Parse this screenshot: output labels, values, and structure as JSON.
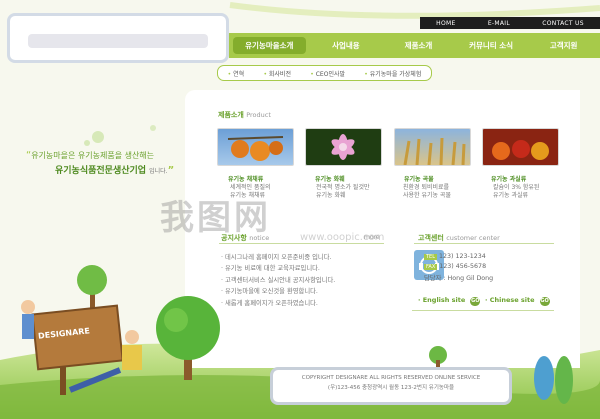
{
  "topbar": {
    "items": [
      "HOME",
      "E-MAIL",
      "CONTACT US"
    ]
  },
  "nav": {
    "items": [
      "유기농마을소개",
      "사업내용",
      "제품소개",
      "커뮤니티 소식",
      "고객지원"
    ]
  },
  "subnav": {
    "items": [
      "연혁",
      "회사비전",
      "CEO인사말",
      "유기농마을 가상체험"
    ]
  },
  "slogan": {
    "line1": "유기농마을은 유기농제품을 생산해는",
    "line2": "유기농식품전문생산기업",
    "line2_suffix": "입니다."
  },
  "product": {
    "title": "제품소개",
    "title_en": "Product",
    "items": [
      {
        "title": "유기농 채채류",
        "desc1": "세계적인 품질의",
        "desc2": "유기농 채채류"
      },
      {
        "title": "유기농 화훼",
        "desc1": "전국적 명소가 될것만",
        "desc2": "유기농 화훼"
      },
      {
        "title": "유기농 곡물",
        "desc1": "친환경 퇴비비료를",
        "desc2": "사용한 유기농 곡물"
      },
      {
        "title": "유기농 과실류",
        "desc1": "칼슘이 3% 함유된",
        "desc2": "유기농 과실류"
      }
    ]
  },
  "notice": {
    "title": "공지사항",
    "title_en": "notice",
    "more": "more",
    "items": [
      "데시그나레 홈페이지 오픈준비중 입니다.",
      "유기농 비료에 대한 교육자료입니다.",
      "고객센터서비스 실시안내 공지사항입니다.",
      "유기농마을에 오신것을 환영합니다.",
      "새롭게 홈페이지가 오픈하였습니다."
    ]
  },
  "contact": {
    "title": "고객센터",
    "title_en": "customer center",
    "tel_label": "TEL",
    "tel": "123) 123-1234",
    "fax_label": "FAX",
    "fax": "123) 456-5678",
    "manager": "담당자 : Hong Gil Dong"
  },
  "sites": {
    "english": "English site",
    "chinese": "Chinese site",
    "go": "GO"
  },
  "sign": {
    "text": "DESIGNARE"
  },
  "footer": {
    "line1": "COPYRIGHT DESIGNARE ALL RIGHTS RESERVED ONLINE SERVICE",
    "line2": "(우)123-456 충청광역시 월동 123-2번지 유기농마을"
  },
  "colors": {
    "accent": "#a7ca4a",
    "accent_dark": "#6aa12c",
    "topbar": "#1e1e1e"
  }
}
